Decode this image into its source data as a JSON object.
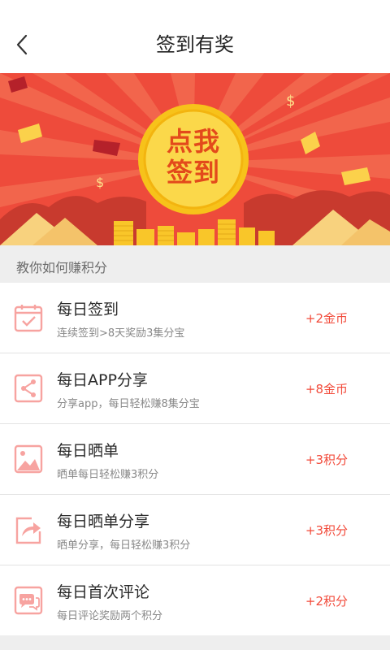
{
  "header": {
    "title": "签到有奖",
    "back_icon": "chevron-left-icon"
  },
  "banner": {
    "coin_line1": "点我",
    "coin_line2": "签到"
  },
  "section": {
    "title": "教你如何赚积分"
  },
  "tasks": [
    {
      "icon": "calendar-check-icon",
      "name": "每日签到",
      "desc": "连续签到>8天奖励3集分宝",
      "reward": "+2金币"
    },
    {
      "icon": "share-icon",
      "name": "每日APP分享",
      "desc": "分享app，每日轻松赚8集分宝",
      "reward": "+8金币"
    },
    {
      "icon": "image-icon",
      "name": "每日晒单",
      "desc": "晒单每日轻松赚3积分",
      "reward": "+3积分"
    },
    {
      "icon": "forward-share-icon",
      "name": "每日晒单分享",
      "desc": "晒单分享，每日轻松赚3积分",
      "reward": "+3积分"
    },
    {
      "icon": "comment-icon",
      "name": "每日首次评论",
      "desc": "每日评论奖励两个积分",
      "reward": "+2积分"
    }
  ],
  "colors": {
    "accent": "#f24a3a",
    "banner_red": "#ee4b3b",
    "coin_gold": "#f9cc20",
    "icon_pink": "#f7a3a0"
  }
}
